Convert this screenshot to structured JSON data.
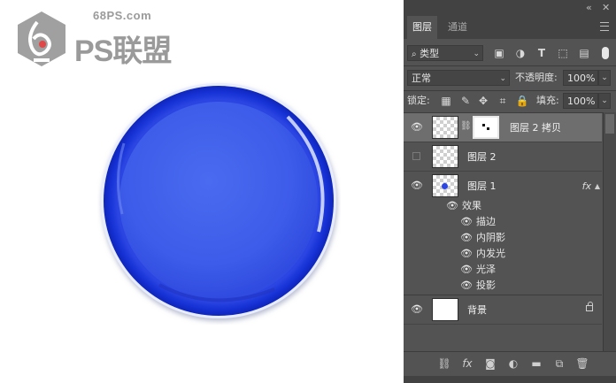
{
  "watermark": {
    "url": "68PS.com",
    "brand": "PS联盟"
  },
  "panel": {
    "top_controls": {
      "collapse": "«",
      "close": "✕"
    },
    "tabs": [
      {
        "label": "图层",
        "active": true
      },
      {
        "label": "通道",
        "active": false
      }
    ],
    "menu_icon": "hamburger-icon",
    "filter": {
      "kind_label": "类型",
      "icons": [
        "image-filter-icon",
        "adjustment-filter-icon",
        "type-filter-icon",
        "shape-filter-icon",
        "smart-object-filter-icon"
      ]
    },
    "blend": {
      "mode": "正常",
      "opacity_label": "不透明度:",
      "opacity_value": "100%"
    },
    "lock": {
      "label": "锁定:",
      "icons": [
        "lock-pixels-icon",
        "lock-paint-icon",
        "lock-position-icon",
        "lock-artboard-icon",
        "lock-all-icon"
      ],
      "fill_label": "填充:",
      "fill_value": "100%"
    },
    "layers": [
      {
        "name": "图层 2 拷贝",
        "visible": true,
        "selected": true,
        "has_mask": true
      },
      {
        "name": "图层 2",
        "visible": false,
        "selected": false
      },
      {
        "name": "图层 1",
        "visible": true,
        "selected": false,
        "fx": "fx"
      },
      {
        "name": "背景",
        "visible": true,
        "selected": false,
        "locked": true
      }
    ],
    "effects": {
      "header": "效果",
      "items": [
        "描边",
        "内阴影",
        "内发光",
        "光泽",
        "投影"
      ]
    },
    "bottom_icons": [
      "link-layers-icon",
      "fx-icon",
      "add-mask-icon",
      "adjustment-layer-icon",
      "new-group-icon",
      "new-layer-icon",
      "delete-icon"
    ],
    "bottom_fx_label": "fx"
  },
  "colors": {
    "panel_bg": "#535353",
    "selected_row": "#6e6e6e",
    "plate_blue": "#3a57e6",
    "plate_rim": "#1c33d8"
  }
}
